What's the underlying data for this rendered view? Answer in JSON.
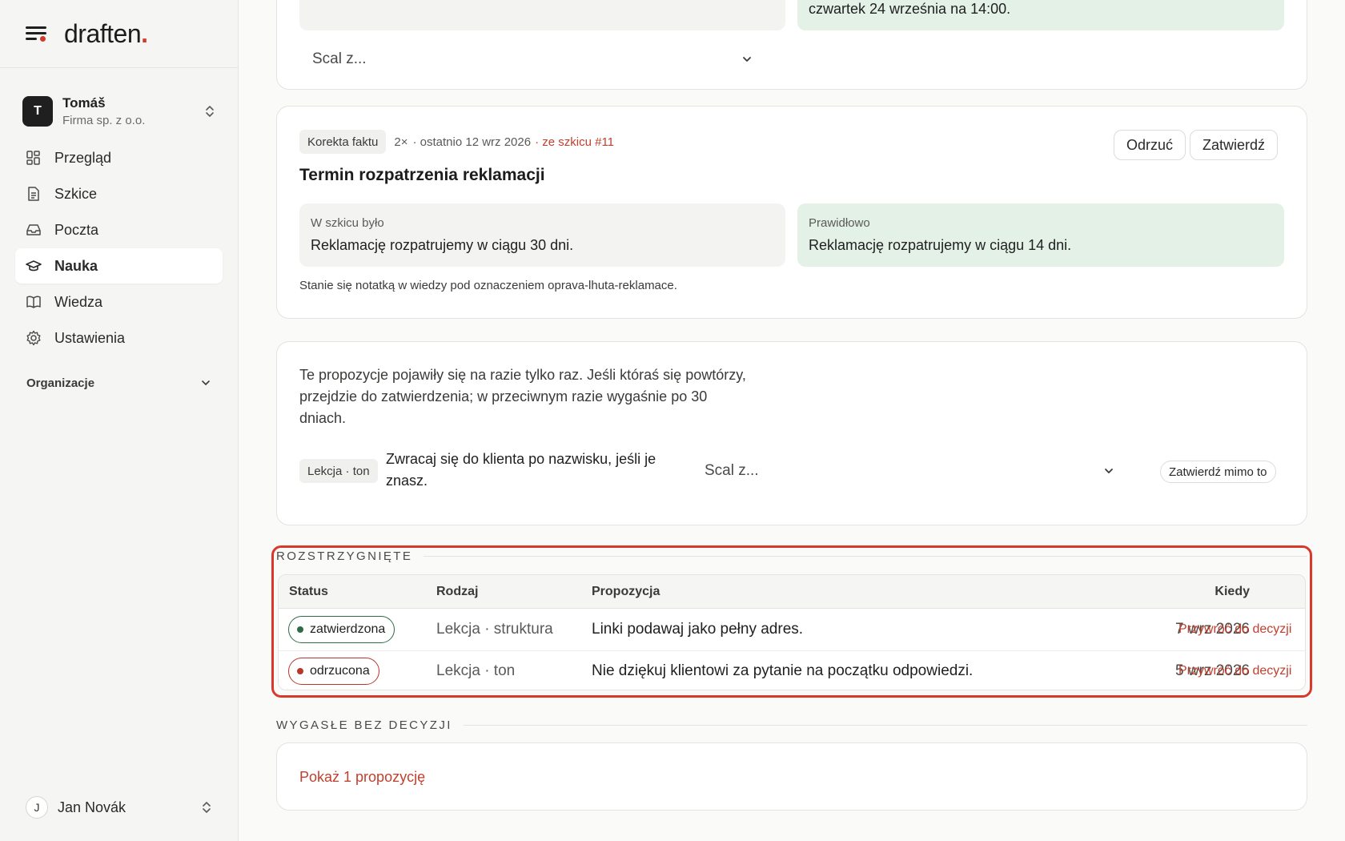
{
  "brand": {
    "name": "draften",
    "dot": "."
  },
  "org": {
    "initial": "T",
    "name": "Tomáš",
    "company": "Firma sp. z o.o."
  },
  "nav": [
    {
      "label": "Przegląd",
      "icon": "dashboard-icon"
    },
    {
      "label": "Szkice",
      "icon": "document-icon"
    },
    {
      "label": "Poczta",
      "icon": "inbox-icon"
    },
    {
      "label": "Nauka",
      "icon": "graduation-cap-icon",
      "active": true
    },
    {
      "label": "Wiedza",
      "icon": "book-icon"
    },
    {
      "label": "Ustawienia",
      "icon": "gear-icon"
    }
  ],
  "organizations_label": "Organizacje",
  "user": {
    "initial": "J",
    "name": "Jan Novák"
  },
  "top_card": {
    "green_text": "czwartek 24 września na 14:00.",
    "merge_placeholder": "Scal z..."
  },
  "fact_card": {
    "tag": "Korekta faktu",
    "count": "2×",
    "last": "· ostatnio 12 wrz 2026",
    "source": "· ze szkicu #11",
    "reject": "Odrzuć",
    "approve": "Zatwierdź",
    "title": "Termin rozpatrzenia reklamacji",
    "was_label": "W szkicu było",
    "was_value": "Reklamację rozpatrujemy w ciągu 30 dni.",
    "correct_label": "Prawidłowo",
    "correct_value": "Reklamację rozpatrujemy w ciągu 14 dni.",
    "note": "Stanie się notatką w wiedzy pod oznaczeniem oprava-lhuta-reklamace."
  },
  "pending_card": {
    "info_line1": "Te propozycje pojawiły się na razie tylko raz. Jeśli któraś się powtórzy,",
    "info_line2": "przejdzie do zatwierdzenia; w przeciwnym razie wygaśnie po 30",
    "info_line3": "dniach.",
    "tag": "Lekcja · ton",
    "text_line1": "Zwracaj się do klienta po nazwisku, jeśli je",
    "text_line2": "znasz.",
    "merge_placeholder": "Scal z...",
    "approve_anyway": "Zatwierdź mimo to"
  },
  "resolved": {
    "title": "ROZSTRZYGNIĘTE",
    "columns": {
      "status": "Status",
      "kind": "Rodzaj",
      "proposal": "Propozycja",
      "when": "Kiedy"
    },
    "rows": [
      {
        "status": "zatwierdzona",
        "kind": "Lekcja · struktura",
        "proposal": "Linki podawaj jako pełny adres.",
        "when": "7 wrz 2026",
        "action": "Przywróć do decyzji"
      },
      {
        "status": "odrzucona",
        "kind": "Lekcja · ton",
        "proposal": "Nie dziękuj klientowi za pytanie na początku odpowiedzi.",
        "when": "5 wrz 2026",
        "action": "Przywróć do decyzji"
      }
    ]
  },
  "expired": {
    "title": "WYGASŁE BEZ DECYZJI",
    "show_link": "Pokaż 1 propozycję"
  },
  "colors": {
    "accent": "#d23a2a",
    "approved": "#2f6b47",
    "rejected": "#b8372a",
    "correct_bg": "#e4f1e7",
    "draft_bg": "#f3f3f1"
  }
}
